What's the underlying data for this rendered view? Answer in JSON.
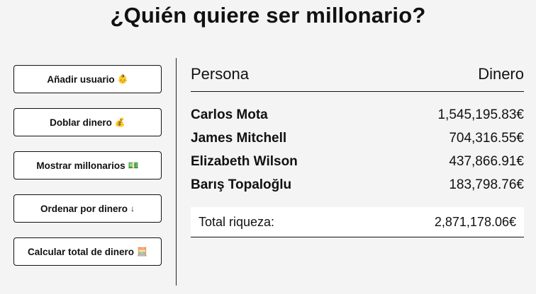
{
  "title": "¿Quién quiere ser millonario?",
  "buttons": [
    {
      "label": "Añadir usuario",
      "icon": "👶"
    },
    {
      "label": "Doblar dinero",
      "icon": "💰"
    },
    {
      "label": "Mostrar millonarios",
      "icon": "💵"
    },
    {
      "label": "Ordenar por dinero",
      "icon": "↓"
    },
    {
      "label": "Calcular total de dinero",
      "icon": "🧮"
    }
  ],
  "table": {
    "header": {
      "person": "Persona",
      "money": "Dinero"
    },
    "rows": [
      {
        "name": "Carlos Mota",
        "money": "1,545,195.83€"
      },
      {
        "name": "James Mitchell",
        "money": "704,316.55€"
      },
      {
        "name": "Elizabeth Wilson",
        "money": "437,866.91€"
      },
      {
        "name": "Barış Topaloğlu",
        "money": "183,798.76€"
      }
    ],
    "total": {
      "label": "Total riqueza:",
      "value": "2,871,178.06€"
    }
  }
}
